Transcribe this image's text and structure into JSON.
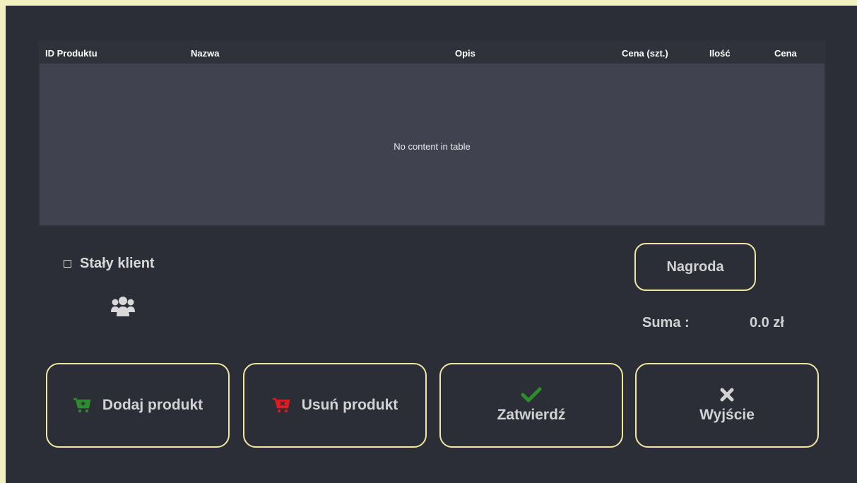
{
  "table": {
    "columns": [
      "ID Produktu",
      "Nazwa",
      "Opis",
      "Cena (szt.)",
      "Ilość",
      "Cena"
    ],
    "rows": [],
    "empty_text": "No content in table"
  },
  "loyal_customer": {
    "label": "Stały klient",
    "checked": false,
    "icon": "users-icon"
  },
  "reward_button": {
    "label": "Nagroda"
  },
  "sum": {
    "label": "Suma :",
    "value": "0.0 zł"
  },
  "actions": {
    "add": {
      "label": "Dodaj produkt",
      "icon": "cart-plus-icon",
      "color": "#2e8b2e"
    },
    "remove": {
      "label": "Usuń produkt",
      "icon": "cart-remove-icon",
      "color": "#e01b1b"
    },
    "confirm": {
      "label": "Zatwierdź",
      "icon": "check-icon",
      "color": "#2e8b2e"
    },
    "exit": {
      "label": "Wyjście",
      "icon": "close-icon",
      "color": "#d2d2d2"
    }
  },
  "colors": {
    "background": "#2b2e36",
    "table_body": "#40434f",
    "button_border": "#efe7a2",
    "text": "#d2d2d2"
  }
}
